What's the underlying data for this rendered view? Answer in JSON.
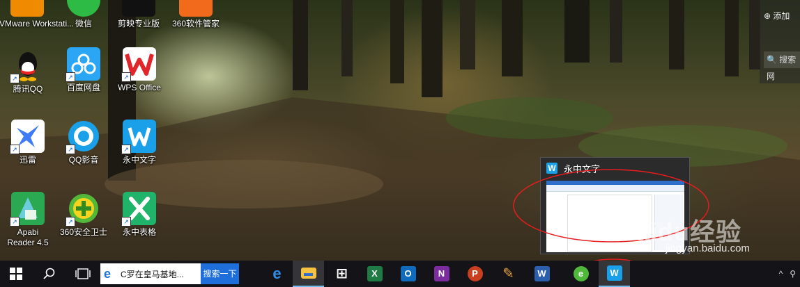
{
  "desktop_icons": [
    {
      "label": "VMware Workstati...",
      "icon": "vmware-icon",
      "color": "#f08a00"
    },
    {
      "label": "微信",
      "icon": "wechat-icon",
      "color": "#2dbb45"
    },
    {
      "label": "剪映专业版",
      "icon": "jianying-icon",
      "color": "#111111"
    },
    {
      "label": "360软件管家",
      "icon": "360-software-icon",
      "color": "#f26b1d"
    },
    {
      "label": "腾讯QQ",
      "icon": "qq-icon",
      "color": "#111111"
    },
    {
      "label": "百度网盘",
      "icon": "baidu-netdisk-icon",
      "color": "#2aa6f5"
    },
    {
      "label": "WPS Office",
      "icon": "wps-office-icon",
      "color": "#e0262a"
    },
    {
      "label": "迅雷",
      "icon": "xunlei-icon",
      "color": "#3d7cf6"
    },
    {
      "label": "QQ影音",
      "icon": "qq-player-icon",
      "color": "#1aa0e8"
    },
    {
      "label": "永中文字",
      "icon": "yozo-writer-icon",
      "color": "#1aa0e8"
    },
    {
      "label": "Apabi Reader 4.5",
      "icon": "apabi-reader-icon",
      "color": "#2aa852"
    },
    {
      "label": "360安全卫士",
      "icon": "360-security-icon",
      "color": "#53b83a"
    },
    {
      "label": "永中表格",
      "icon": "yozo-sheet-icon",
      "color": "#20b46a"
    }
  ],
  "right_panel": {
    "add_label": "添加",
    "search_label": "搜索网"
  },
  "preview": {
    "title": "永中文字",
    "app_icon": "W"
  },
  "watermark": {
    "brand": "Baidu经验",
    "url": "jingyan.baidu.com"
  },
  "taskbar": {
    "search_text": "C罗在皇马基地...",
    "search_button": "搜索一下",
    "apps": [
      {
        "name": "edge-icon",
        "glyph": "e",
        "color": "#2f8fe8"
      },
      {
        "name": "file-explorer-icon",
        "glyph": "▬",
        "color": "#f5c242"
      },
      {
        "name": "store-icon",
        "glyph": "⊞",
        "color": "#ffffff"
      },
      {
        "name": "excel-icon",
        "glyph": "X",
        "color": "#1f7a44"
      },
      {
        "name": "outlook-icon",
        "glyph": "O",
        "color": "#0f6cbd"
      },
      {
        "name": "onenote-icon",
        "glyph": "N",
        "color": "#7b2da0"
      },
      {
        "name": "powerpoint-icon",
        "glyph": "P",
        "color": "#c8401f"
      },
      {
        "name": "paint-icon",
        "glyph": "✎",
        "color": "#e9a33c"
      },
      {
        "name": "word-icon",
        "glyph": "W",
        "color": "#2b5fae"
      },
      {
        "name": "360-browser-icon",
        "glyph": "e",
        "color": "#4fb83b"
      },
      {
        "name": "yozo-writer-taskbar-icon",
        "glyph": "W",
        "color": "#1aa0e8"
      }
    ],
    "tray_text": "^"
  }
}
